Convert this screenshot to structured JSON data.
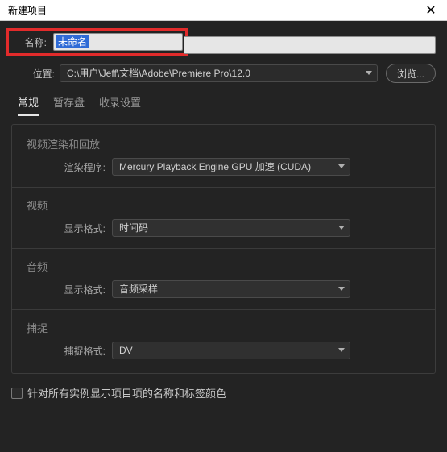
{
  "window": {
    "title": "新建项目"
  },
  "fields": {
    "name_label": "名称:",
    "name_value": "未命名",
    "location_label": "位置:",
    "location_value": "C:\\用户\\Jeff\\文档\\Adobe\\Premiere Pro\\12.0",
    "browse_label": "浏览..."
  },
  "tabs": {
    "general": "常规",
    "scratch": "暂存盘",
    "ingest": "收录设置"
  },
  "sections": {
    "render_title": "视频渲染和回放",
    "render_label": "渲染程序:",
    "render_value": "Mercury Playback Engine GPU 加速 (CUDA)",
    "video_title": "视频",
    "video_label": "显示格式:",
    "video_value": "时间码",
    "audio_title": "音频",
    "audio_label": "显示格式:",
    "audio_value": "音频采样",
    "capture_title": "捕捉",
    "capture_label": "捕捉格式:",
    "capture_value": "DV"
  },
  "footer": {
    "checkbox_label": "针对所有实例显示项目项的名称和标签颜色"
  }
}
